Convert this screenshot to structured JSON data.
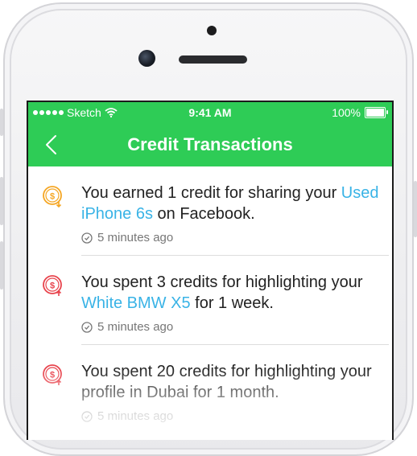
{
  "status_bar": {
    "carrier": "Sketch",
    "time": "9:41 AM",
    "battery": "100%"
  },
  "header": {
    "title": "Credit Transactions"
  },
  "colors": {
    "accent": "#2ecc56",
    "link": "#39b3e6",
    "earned_icon": "#f5a623",
    "spent_icon": "#e8434c"
  },
  "transactions": [
    {
      "icon": "coin-earned-icon",
      "prefix": "You earned 1 credit for sharing your ",
      "link": "Used iPhone 6s",
      "suffix": " on Facebook.",
      "time": "5 minutes ago"
    },
    {
      "icon": "coin-spent-icon",
      "prefix": "You spent 3 credits for highlighting your ",
      "link": "White BMW X5",
      "suffix": " for 1 week.",
      "time": "5 minutes ago"
    },
    {
      "icon": "coin-spent-icon",
      "prefix": "You spent 20 credits for highlighting your profile in Dubai for 1 month.",
      "link": "",
      "suffix": "",
      "time": "5 minutes ago"
    }
  ]
}
